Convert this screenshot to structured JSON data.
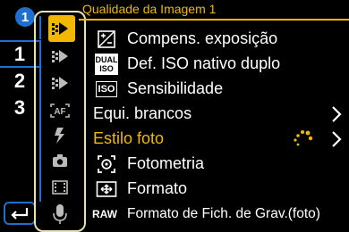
{
  "page_tabs": {
    "badge": "1",
    "items": [
      {
        "label": "1"
      },
      {
        "label": "2"
      },
      {
        "label": "3"
      }
    ]
  },
  "header": {
    "title": "Qualidade da Imagem 1"
  },
  "categories": [
    {
      "name": "photo-menu-icon",
      "selected": true
    },
    {
      "name": "video-menu-icon",
      "selected": false
    },
    {
      "name": "video-menu-icon",
      "selected": false
    },
    {
      "name": "af-icon",
      "selected": false,
      "text": "AF"
    },
    {
      "name": "flash-icon",
      "selected": false
    },
    {
      "name": "camera-icon",
      "selected": false
    },
    {
      "name": "film-icon",
      "selected": false
    },
    {
      "name": "microphone-icon",
      "selected": false
    }
  ],
  "menu": {
    "items": [
      {
        "label": "Compens. exposição",
        "icon": "exposure-comp-icon"
      },
      {
        "label": "Def. ISO nativo duplo",
        "icon": "dual-iso-icon",
        "icon_text_top": "DUAL",
        "icon_text_bottom": "ISO"
      },
      {
        "label": "Sensibilidade",
        "icon": "iso-icon",
        "icon_text": "ISO"
      },
      {
        "label": "Equi. brancos",
        "icon": "",
        "has_submenu": true
      },
      {
        "label": "Estilo foto",
        "icon": "",
        "highlighted": true,
        "has_submenu": true
      },
      {
        "label": "Fotometria",
        "icon": "metering-icon"
      },
      {
        "label": "Formato",
        "icon": "aspect-icon"
      },
      {
        "label": "Formato de Fich. de Grav.(foto)",
        "icon": "raw-icon",
        "icon_text": "RAW"
      }
    ]
  },
  "colors": {
    "accent": "#f2b800",
    "blue": "#1e6fd0",
    "frame": "#e8e3b4"
  }
}
